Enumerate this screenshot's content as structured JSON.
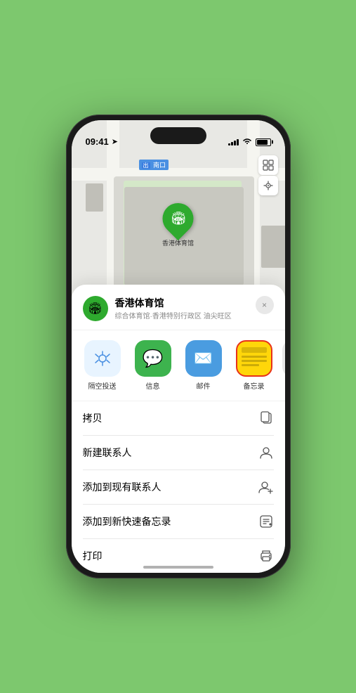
{
  "status_bar": {
    "time": "09:41",
    "location_arrow": "▲"
  },
  "map": {
    "label_nankou": "南口",
    "controls": {
      "map_icon": "🗺",
      "location_icon": "➤"
    },
    "pin_label": "香港体育馆"
  },
  "venue_sheet": {
    "name": "香港体育馆",
    "subtitle": "综合体育馆·香港特别行政区 油尖旺区",
    "close_label": "×",
    "icon": "🏟"
  },
  "share_items": [
    {
      "id": "airdrop",
      "label": "隔空投送",
      "type": "airdrop"
    },
    {
      "id": "messages",
      "label": "信息",
      "type": "messages"
    },
    {
      "id": "mail",
      "label": "邮件",
      "type": "mail"
    },
    {
      "id": "notes",
      "label": "备忘录",
      "type": "notes"
    }
  ],
  "action_items": [
    {
      "id": "copy",
      "label": "拷贝",
      "icon": "copy"
    },
    {
      "id": "new-contact",
      "label": "新建联系人",
      "icon": "person"
    },
    {
      "id": "add-existing",
      "label": "添加到现有联系人",
      "icon": "person-add"
    },
    {
      "id": "add-note",
      "label": "添加到新快速备忘录",
      "icon": "note"
    },
    {
      "id": "print",
      "label": "打印",
      "icon": "printer"
    }
  ]
}
